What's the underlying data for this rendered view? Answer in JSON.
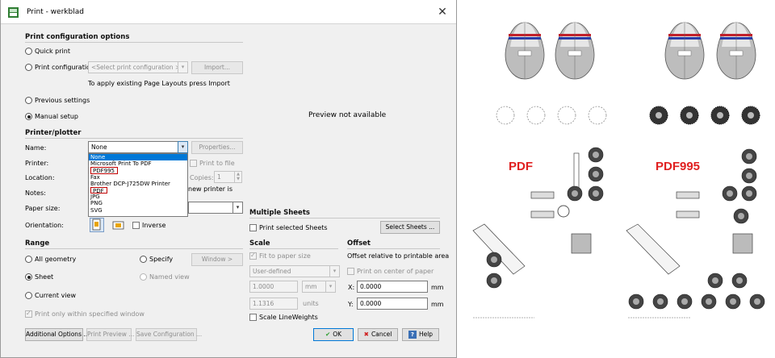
{
  "window": {
    "title": "Print - werkblad",
    "close_glyph": "✕"
  },
  "config": {
    "heading": "Print configuration options",
    "quick_print": "Quick print",
    "print_configuration": "Print configuration:",
    "select_placeholder": "<Select print configuration >",
    "import_button": "Import...",
    "hint": "To apply existing Page Layouts press Import",
    "previous_settings": "Previous settings",
    "manual_setup": "Manual setup"
  },
  "preview_text": "Preview not available",
  "printer": {
    "heading": "Printer/plotter",
    "name_label": "Name:",
    "name_value": "None",
    "properties_button": "Properties...",
    "printer_label": "Printer:",
    "print_to_file": "Print to file",
    "location_label": "Location:",
    "copies_label": "Copies:",
    "copies_value": "1",
    "notes_label": "Notes:",
    "notes_suffix": "new printer is",
    "paper_size_label": "Paper size:",
    "orientation_label": "Orientation:",
    "inverse_label": "Inverse",
    "options": [
      "None",
      "Microsoft Print To PDF",
      "PDF995",
      "Fax",
      "Brother DCP-J725DW Printer",
      "PDF",
      "JPG",
      "PNG",
      "SVG"
    ]
  },
  "multiple_sheets": {
    "heading": "Multiple Sheets",
    "print_selected": "Print selected Sheets",
    "select_sheets_button": "Select Sheets ..."
  },
  "range": {
    "heading": "Range",
    "all_geometry": "All geometry",
    "specify": "Specify",
    "window_button": "Window >",
    "sheet": "Sheet",
    "named_view": "Named view",
    "current_view": "Current view",
    "print_within_window": "Print only within specified window"
  },
  "scale": {
    "heading": "Scale",
    "fit_to_paper": "Fit to paper size",
    "mode_value": "User-defined",
    "value1": "1.0000",
    "unit1": "mm",
    "value2": "1.1316",
    "unit2": "units",
    "scale_lineweights": "Scale LineWeights"
  },
  "offset": {
    "heading": "Offset",
    "relative": "Offset relative to printable area",
    "center": "Print on center of paper",
    "x_label": "X:",
    "x_value": "0.0000",
    "x_unit": "mm",
    "y_label": "Y:",
    "y_value": "0.0000",
    "y_unit": "mm"
  },
  "footer": {
    "additional_options": "Additional Options ...",
    "print_preview": "Print Preview ...",
    "save_configuration": "Save Configuration ...",
    "ok": "OK",
    "ok_glyph": "✔",
    "cancel": "Cancel",
    "cancel_glyph": "✖",
    "help": "Help",
    "help_glyph": "?"
  },
  "compare": {
    "left_label": "PDF",
    "right_label": "PDF995"
  },
  "colors": {
    "accent": "#0078d7",
    "highlight_box": "#c00000",
    "compare_label": "#e02020"
  }
}
